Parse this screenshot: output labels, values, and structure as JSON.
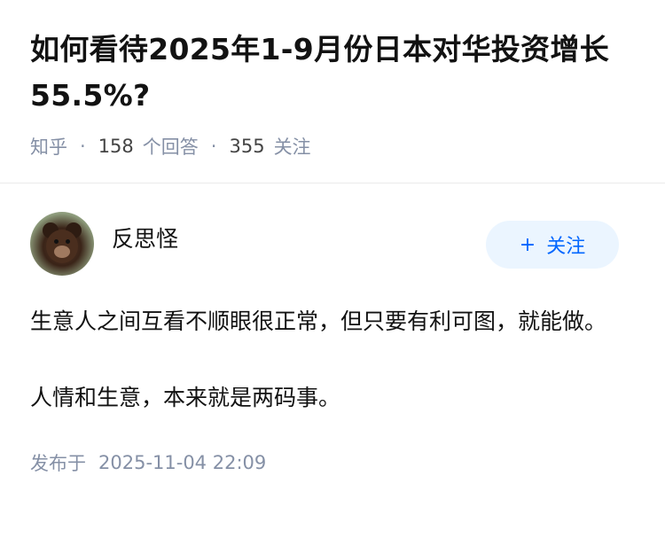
{
  "question": {
    "title_line1": "如何看待2025年1-9月份日本对华投资增长",
    "title_line2": "55.5%?",
    "source": "知乎",
    "answer_count": "158",
    "answer_label": "个回答",
    "follower_count": "355",
    "follower_label": "关注"
  },
  "answer": {
    "author_name": "反思怪",
    "avatar_icon": "bear-cub-avatar",
    "follow_label": "关注",
    "follow_icon": "plus-icon",
    "paragraphs": [
      "生意人之间互看不顺眼很正常，但只要有利可图，就能做。",
      "人情和生意，本来就是两码事。"
    ],
    "publish_label": "发布于",
    "publish_time": "2025-11-04 22:09"
  },
  "colors": {
    "accent": "#0066ff",
    "follow_bg": "#ebf5ff",
    "meta_text": "#8590a6",
    "body_text": "#121212"
  }
}
